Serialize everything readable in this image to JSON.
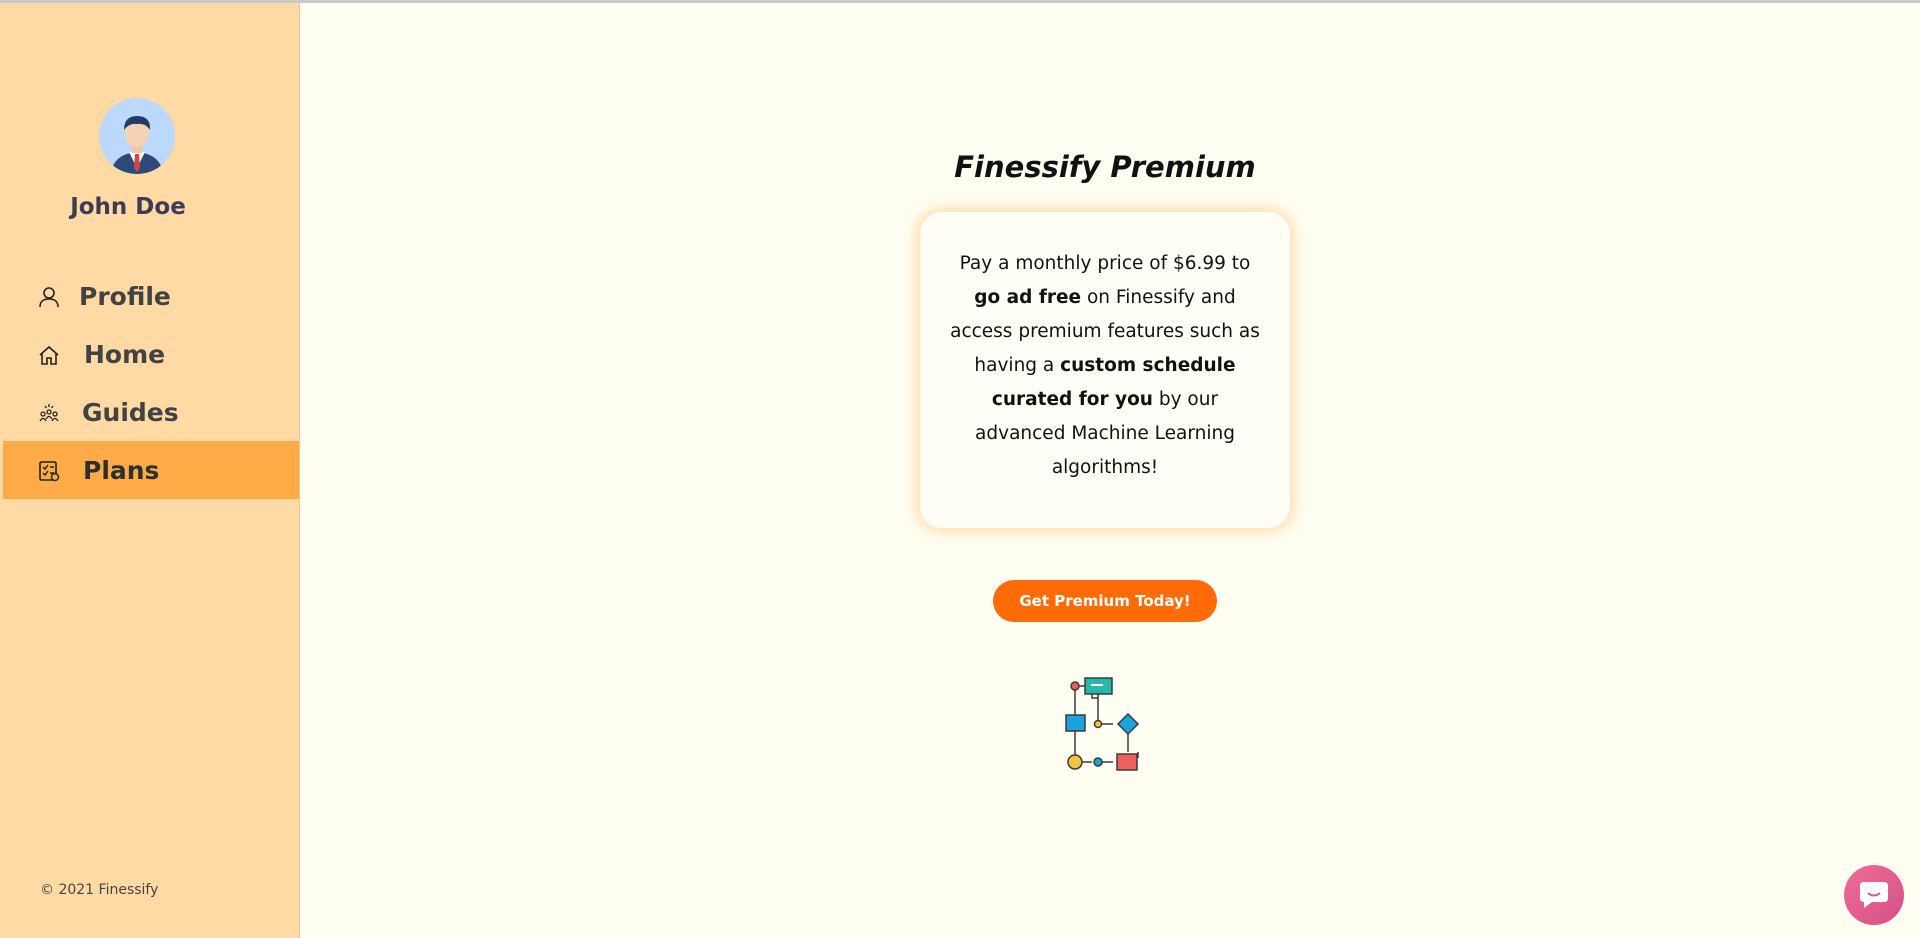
{
  "sidebar": {
    "user_name": "John Doe",
    "nav": [
      {
        "label": "Profile",
        "icon": "user-icon",
        "active": false
      },
      {
        "label": "Home",
        "icon": "home-icon",
        "active": false
      },
      {
        "label": "Guides",
        "icon": "guides-icon",
        "active": false
      },
      {
        "label": "Plans",
        "icon": "plans-icon",
        "active": true
      }
    ],
    "copyright": "© 2021 Finessify"
  },
  "main": {
    "title": "Finessify Premium",
    "card": {
      "part1": "Pay a monthly price of $6.99 to ",
      "bold1": "go ad free",
      "part2": " on Finessify and access premium features such as having a ",
      "bold2": "custom schedule curated for you",
      "part3": " by our advanced Machine Learning algorithms!"
    },
    "cta_label": "Get Premium Today!"
  },
  "colors": {
    "sidebar_bg": "#ffdaa5",
    "active_nav_bg": "#ffab48",
    "page_bg": "#fffef2",
    "cta_bg": "#ff6b06",
    "chat_bubble": "#e05d8c"
  },
  "icons": [
    "avatar",
    "user-icon",
    "home-icon",
    "guides-icon",
    "plans-icon",
    "flowchart-illustration",
    "chat-icon"
  ]
}
